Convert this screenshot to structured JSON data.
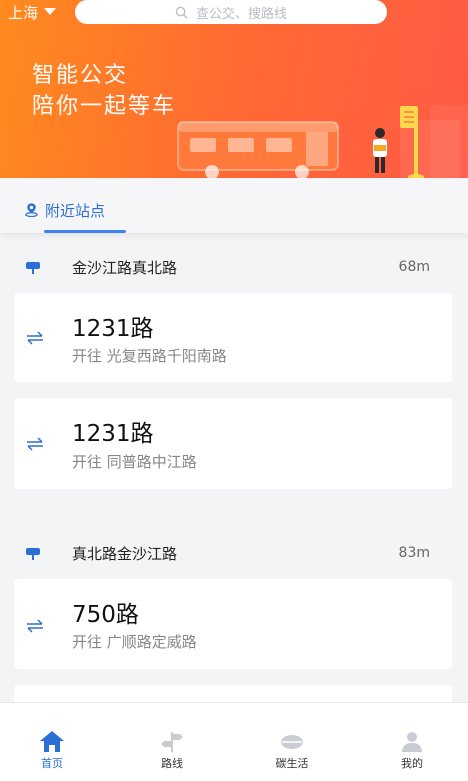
{
  "header": {
    "city": "上海",
    "search_placeholder": "查公交、搜路线"
  },
  "banner": {
    "line1": "智能公交",
    "line2": "陪你一起等车"
  },
  "tabs": {
    "nearby": "附近站点"
  },
  "stops": [
    {
      "name": "金沙江路真北路",
      "distance": "68m",
      "routes": [
        {
          "route": "1231路",
          "dest": "开往 光复西路千阳南路"
        },
        {
          "route": "1231路",
          "dest": "开往 同普路中江路"
        }
      ]
    },
    {
      "name": "真北路金沙江路",
      "distance": "83m",
      "routes": [
        {
          "route": "750路",
          "dest": "开往 广顺路定威路"
        }
      ]
    }
  ],
  "nav": {
    "home": "首页",
    "routes": "路线",
    "carbon": "碳生活",
    "mine": "我的"
  },
  "colors": {
    "accent": "#2b6fd6",
    "banner_start": "#ff8a1e",
    "banner_end": "#ff5a45"
  }
}
